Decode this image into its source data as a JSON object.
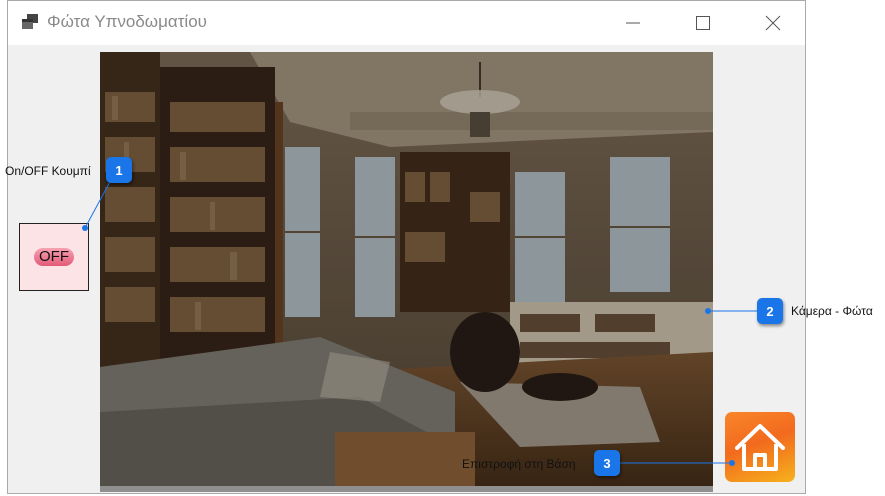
{
  "window": {
    "title": "Φώτα Υπνοδωματίου",
    "icon": "app-window-icon",
    "controls": [
      "minimize-icon",
      "maximize-icon",
      "close-icon"
    ]
  },
  "camera": {
    "label": "Κάμερα - Φώτα"
  },
  "toggle": {
    "label": "On/OFF Κουμπί",
    "state": "OFF"
  },
  "home": {
    "label": "Επιστροφή στη Βάση",
    "icon": "home-icon"
  },
  "callouts": {
    "toggle_number": "1",
    "camera_number": "2",
    "home_number": "3"
  },
  "colors": {
    "callout": "#1a75e8",
    "home_button": "#f57a22",
    "toggle_pink": "#fbe3e6"
  }
}
